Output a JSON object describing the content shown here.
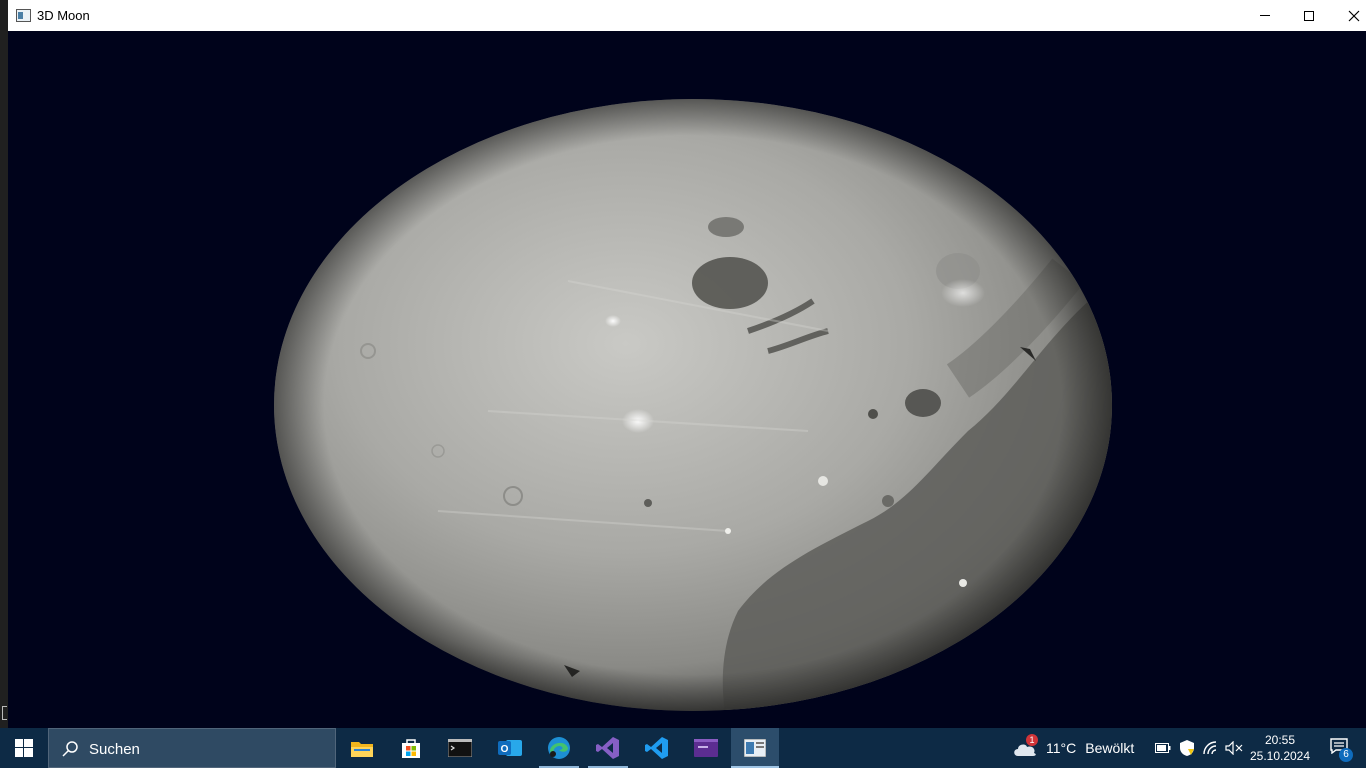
{
  "window": {
    "title": "3D Moon"
  },
  "taskbar": {
    "search_placeholder": "Suchen",
    "apps": [
      "file-explorer",
      "microsoft-store",
      "terminal",
      "outlook",
      "edge",
      "visual-studio",
      "vscode",
      "app-launcher",
      "3d-moon"
    ],
    "weather": {
      "badge": "1",
      "temp": "11°C",
      "desc": "Bewölkt"
    },
    "clock": {
      "time": "20:55",
      "date": "25.10.2024"
    },
    "notifications": {
      "count": "6"
    }
  },
  "colors": {
    "space": "#00031b",
    "taskbar": "#0d2a45",
    "moon_highland": "#b8b8b4",
    "moon_mare": "#5e5e5a"
  }
}
